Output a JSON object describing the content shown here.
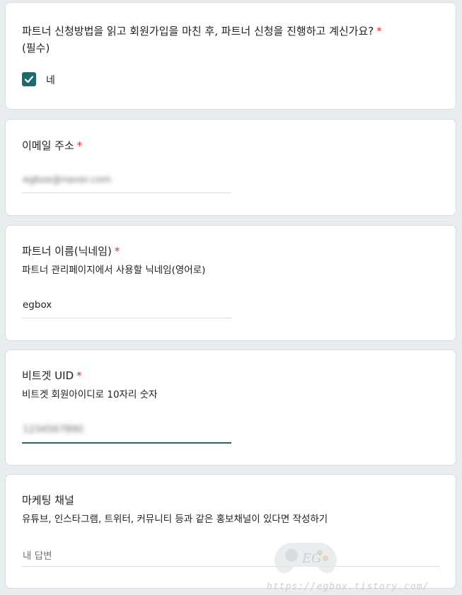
{
  "questions": {
    "q1": {
      "title": "파트너 신청방법을 읽고 회원가입을 마친 후, 파트너 신청을 진행하고 계신가요?",
      "title_suffix": "(필수)",
      "required_mark": "*",
      "checkbox_label": "네",
      "checked": true
    },
    "q2": {
      "title": "이메일 주소",
      "required_mark": "*",
      "value": "egbox@naver.com"
    },
    "q3": {
      "title": "파트너 이름(닉네임)",
      "required_mark": "*",
      "description": "파트너 관리페이지에서 사용할 닉네임(영어로)",
      "value": "egbox"
    },
    "q4": {
      "title": "비트겟 UID",
      "required_mark": "*",
      "description": "비트겟 회원아이디로 10자리 숫자",
      "value": "1234567890"
    },
    "q5": {
      "title": "마케팅 채널",
      "description": "유튜브, 인스타그램, 트위터, 커뮤니티 등과 같은 홍보채널이 있다면 작성하기",
      "placeholder": "내 답변"
    }
  },
  "watermark": {
    "logo_text": "EG",
    "url": "https://egbox.tistory.com/"
  },
  "colors": {
    "accent": "#1e6b6b",
    "required": "#d93025",
    "background": "#e8eef0"
  }
}
